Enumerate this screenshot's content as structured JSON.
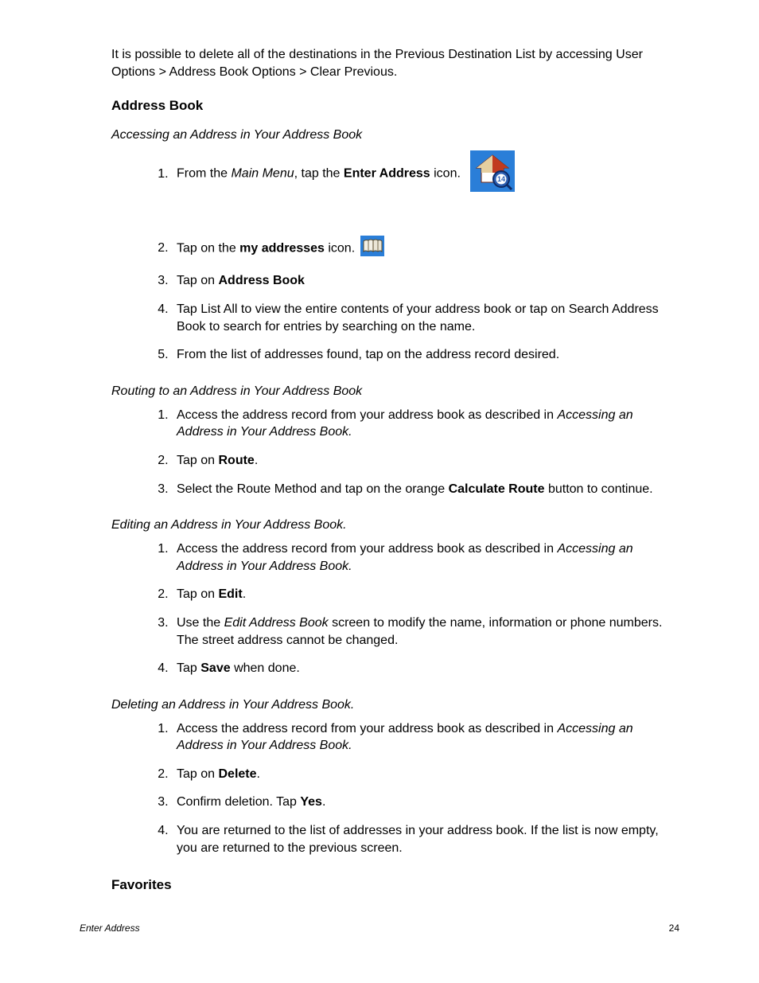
{
  "intro": "It is possible to delete all of the destinations in the Previous Destination List by accessing User Options > Address Book Options > Clear Previous.",
  "headings": {
    "address_book": "Address Book",
    "favorites": "Favorites"
  },
  "sections": {
    "accessing": {
      "title": "Accessing an Address in Your Address Book",
      "steps": {
        "s1_a": "From the ",
        "s1_b": "Main Menu",
        "s1_c": ", tap the ",
        "s1_d": "Enter Address",
        "s1_e": " icon.",
        "s2_a": "Tap on the ",
        "s2_b": "my addresses",
        "s2_c": " icon.",
        "s3_a": "Tap on ",
        "s3_b": "Address Book",
        "s4": "Tap List All to view the entire contents of your address book or tap on Search Address Book to search for entries by searching on the name.",
        "s5": "From the list of addresses found, tap on the address record desired."
      }
    },
    "routing": {
      "title": "Routing to an Address in Your Address Book",
      "steps": {
        "s1_a": "Access the address record from your address book as described in ",
        "s1_b": "Accessing an Address in Your Address Book.",
        "s2_a": "Tap on ",
        "s2_b": "Route",
        "s2_c": ".",
        "s3_a": "Select the Route Method and tap on the orange ",
        "s3_b": "Calculate Route",
        "s3_c": " button to continue."
      }
    },
    "editing": {
      "title": "Editing an Address in Your Address Book.",
      "steps": {
        "s1_a": "Access the address record from your address book as described in ",
        "s1_b": "Accessing an Address in Your Address Book.",
        "s2_a": "Tap on ",
        "s2_b": "Edit",
        "s2_c": ".",
        "s3_a": "Use the ",
        "s3_b": "Edit Address Book",
        "s3_c": " screen to modify the name, information or phone numbers.  The street address cannot be changed.",
        "s4_a": "Tap ",
        "s4_b": "Save",
        "s4_c": " when done."
      }
    },
    "deleting": {
      "title": "Deleting an Address in Your Address Book.",
      "steps": {
        "s1_a": "Access the address record from your address book as described in ",
        "s1_b": "Accessing an Address in Your Address Book.",
        "s2_a": "Tap on ",
        "s2_b": "Delete",
        "s2_c": ".",
        "s3_a": "Confirm deletion.  Tap ",
        "s3_b": "Yes",
        "s3_c": ".",
        "s4": "You are returned to the list of addresses in your address book.  If the list is now empty, you are returned to the previous screen."
      }
    }
  },
  "footer": {
    "section": "Enter Address",
    "page": "24"
  },
  "icons": {
    "enter_address": "enter-address-icon",
    "my_addresses": "my-addresses-icon"
  }
}
